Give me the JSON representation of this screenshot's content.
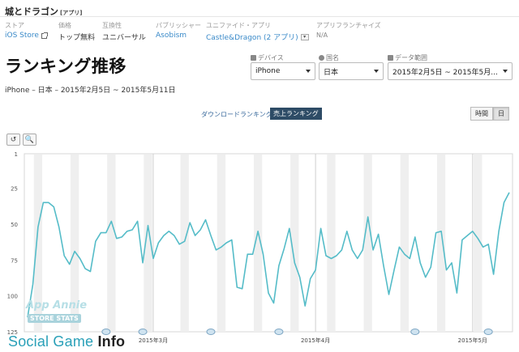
{
  "app": {
    "title": "城とドラゴン",
    "title_tag": "[アプリ]"
  },
  "meta": [
    {
      "key": "ストア",
      "value": "iOS Store",
      "style": "link",
      "icon": "external-link-icon"
    },
    {
      "key": "価格",
      "value": "トップ無料",
      "style": "plain"
    },
    {
      "key": "互換性",
      "value": "ユニバーサル",
      "style": "plain"
    },
    {
      "key": "パブリッシャー",
      "value": "Asobism",
      "style": "link"
    },
    {
      "key": "ユニファイド・アプリ",
      "value": "Castle&Dragon (2 アプリ)",
      "style": "link",
      "icon": "dropdown-icon"
    },
    {
      "key": "アプリフランチャイズ",
      "value": "N/A",
      "style": "muted"
    }
  ],
  "page": {
    "title": "ランキング推移",
    "subtitle": "iPhone – 日本 – 2015年2月5日 ~ 2015年5月11日"
  },
  "filters": {
    "device": {
      "label": "デバイス",
      "value": "iPhone",
      "icon": "device-icon"
    },
    "country": {
      "label": "国名",
      "value": "日本",
      "icon": "globe-icon"
    },
    "date_range": {
      "label": "データ範囲",
      "value": "2015年2月5日 ~ 2015年5月...",
      "icon": "calendar-icon"
    }
  },
  "ranking_tabs": {
    "downloads": "ダウンロードランキング",
    "revenue": "売上ランキング",
    "active": "revenue"
  },
  "period": {
    "hourly": "時間",
    "daily": "日",
    "active": "daily"
  },
  "tools": {
    "reset": "↺",
    "zoom": "🔍"
  },
  "chart_data": {
    "type": "line",
    "y_axis": {
      "reversed": true,
      "ylim": [
        1,
        125
      ],
      "ticks": [
        1,
        25,
        50,
        75,
        100,
        125
      ]
    },
    "x_labels": [
      "2015年3月",
      "2015年4月",
      "2015年5月"
    ],
    "x_range": [
      "2015-02-05",
      "2015-05-11"
    ],
    "series": [
      {
        "color": "#55bcc8",
        "values": [
          115,
          92,
          52,
          35,
          35,
          38,
          52,
          72,
          78,
          69,
          74,
          81,
          83,
          62,
          56,
          56,
          48,
          60,
          59,
          55,
          54,
          48,
          77,
          51,
          74,
          63,
          58,
          55,
          58,
          64,
          62,
          49,
          58,
          54,
          47,
          58,
          68,
          66,
          63,
          61,
          94,
          95,
          71,
          71,
          55,
          71,
          98,
          105,
          79,
          67,
          53,
          77,
          87,
          107,
          88,
          82,
          53,
          72,
          74,
          72,
          68,
          55,
          68,
          74,
          68,
          45,
          68,
          57,
          79,
          99,
          82,
          66,
          71,
          74,
          59,
          77,
          87,
          80,
          56,
          55,
          82,
          77,
          98,
          61,
          58,
          55,
          60,
          66,
          64,
          85,
          55,
          35,
          28
        ]
      }
    ],
    "event_markers": 6
  },
  "watermark": {
    "line1": "App Annie",
    "line2": "STORE STATS"
  },
  "brand": {
    "pre": "Social Game ",
    "bold": "Info"
  }
}
